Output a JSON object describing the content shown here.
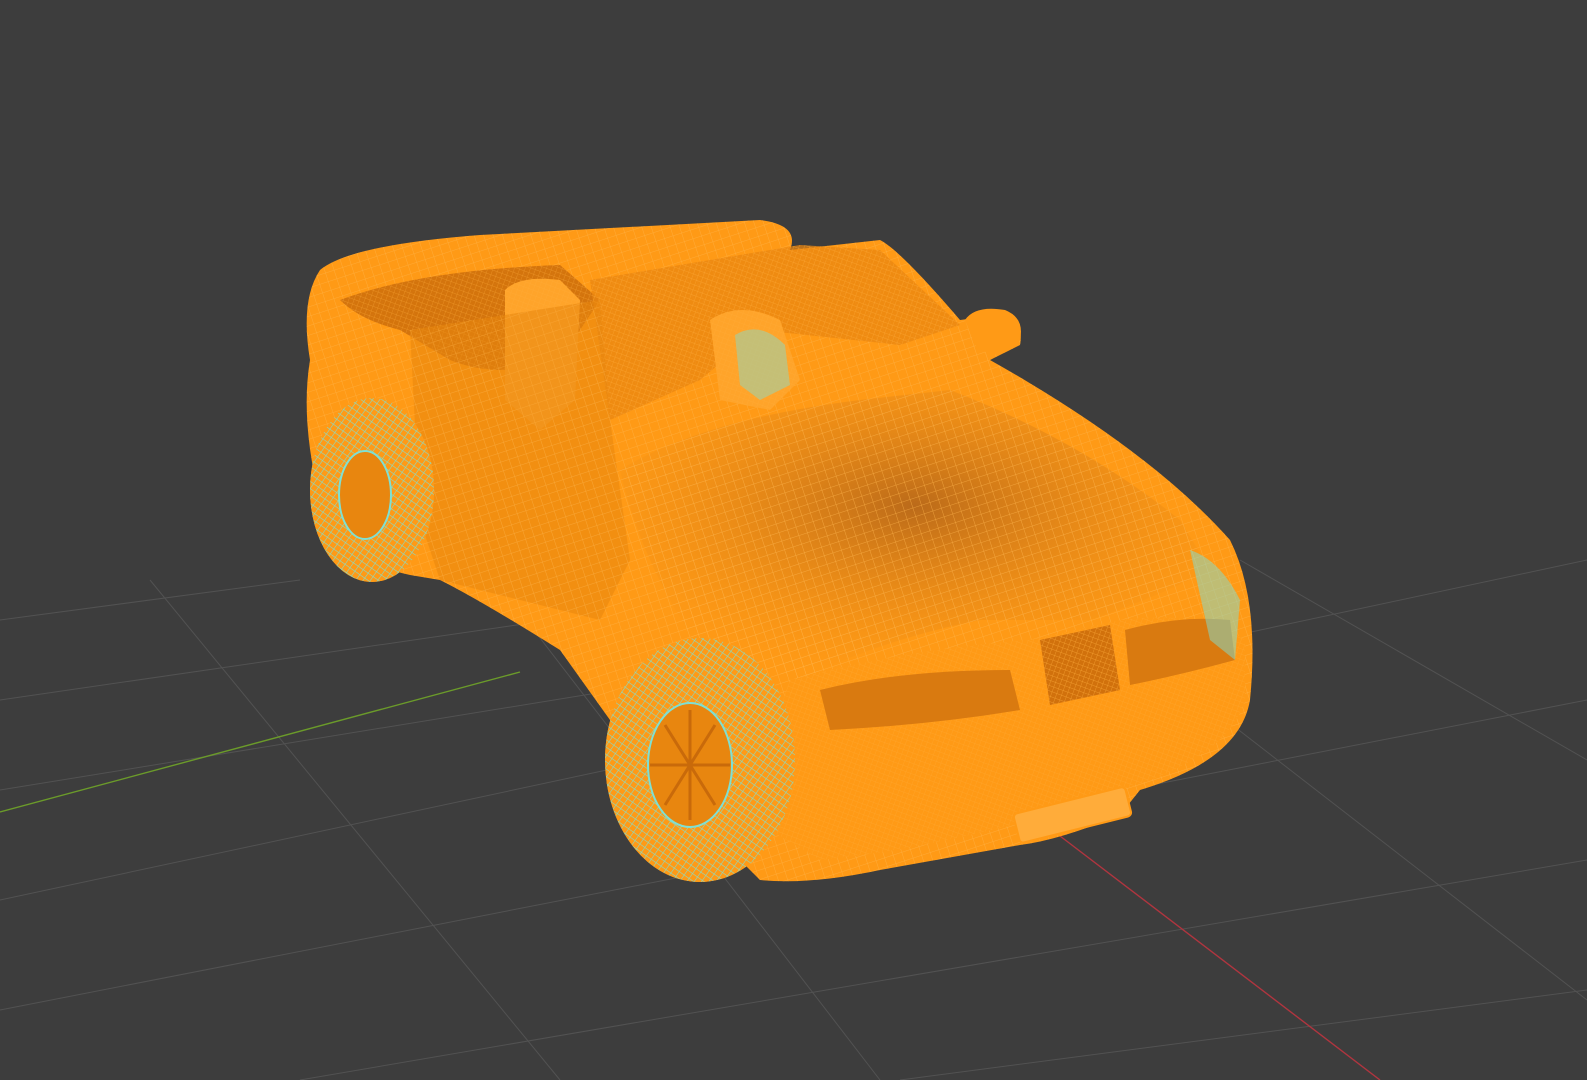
{
  "viewport": {
    "name": "3d-viewport",
    "background": "#3d3d3d",
    "grid_color": "#525252",
    "x_axis_color": "#b0353f",
    "y_axis_color": "#6b9b2a",
    "mode": "wireframe"
  },
  "model": {
    "name": "convertible-car-wireframe",
    "body_color": "#ff9a16",
    "body_dark_color": "#c96a0a",
    "wire_color": "#ffb347",
    "selected_edge_color": "#7fe0d2",
    "parts": [
      "body",
      "hood",
      "windshield",
      "seats",
      "front-wheel-left",
      "rear-wheel-left",
      "mirror",
      "grille",
      "headlight-left",
      "headlight-right",
      "license-plate"
    ]
  }
}
